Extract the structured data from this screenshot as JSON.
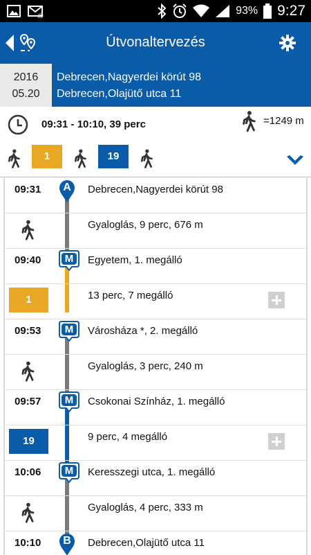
{
  "statusbar": {
    "battery": "93%",
    "time": "9:27"
  },
  "appbar": {
    "title": "Útvonaltervezés"
  },
  "search": {
    "date_year": "2016",
    "date_day": "05.20",
    "from": "Debrecen,Nagyerdei körút 98",
    "to": "Debrecen,Olajütő utca 11"
  },
  "summary": {
    "time_range": "09:31 - 10:10, 39 perc",
    "walk_distance": "=1249 m"
  },
  "legs": {
    "bus1": "1",
    "bus2": "19"
  },
  "colors": {
    "brand": "#0b5ca8",
    "line1": "#e9a823",
    "line19": "#0b5ca8",
    "walk_line": "#7a7a7a"
  },
  "icons": [
    "image-icon",
    "mail-icon",
    "bluetooth-icon",
    "alarm-icon",
    "wifi-icon",
    "signal-icon",
    "battery-icon",
    "back-icon",
    "route-icon",
    "gear-icon",
    "clock-icon",
    "walk-icon",
    "chevron-down-icon",
    "plus-icon",
    "stop-pin-icon"
  ],
  "rows": [
    {
      "time": "09:31",
      "text": "Debrecen,Nagyerdei körút 98",
      "pin": "A"
    },
    {
      "text": "Gyaloglás, 9 perc, 676 m"
    },
    {
      "time": "09:40",
      "text": "Egyetem, 1. megálló",
      "pin": "M"
    },
    {
      "badge": "1",
      "text": "13 perc, 7 megálló"
    },
    {
      "time": "09:53",
      "text": "Városháza *, 2. megálló",
      "pin": "M"
    },
    {
      "text": "Gyaloglás, 3 perc, 240 m"
    },
    {
      "time": "09:57",
      "text": "Csokonai Színház, 1. megálló",
      "pin": "M"
    },
    {
      "badge": "19",
      "text": "9 perc, 4 megálló"
    },
    {
      "time": "10:06",
      "text": "Keresszegi utca, 1. megálló",
      "pin": "M"
    },
    {
      "text": "Gyaloglás, 4 perc, 333 m"
    },
    {
      "time": "10:10",
      "text": "Debrecen,Olajütő utca 11",
      "pin": "B"
    }
  ]
}
